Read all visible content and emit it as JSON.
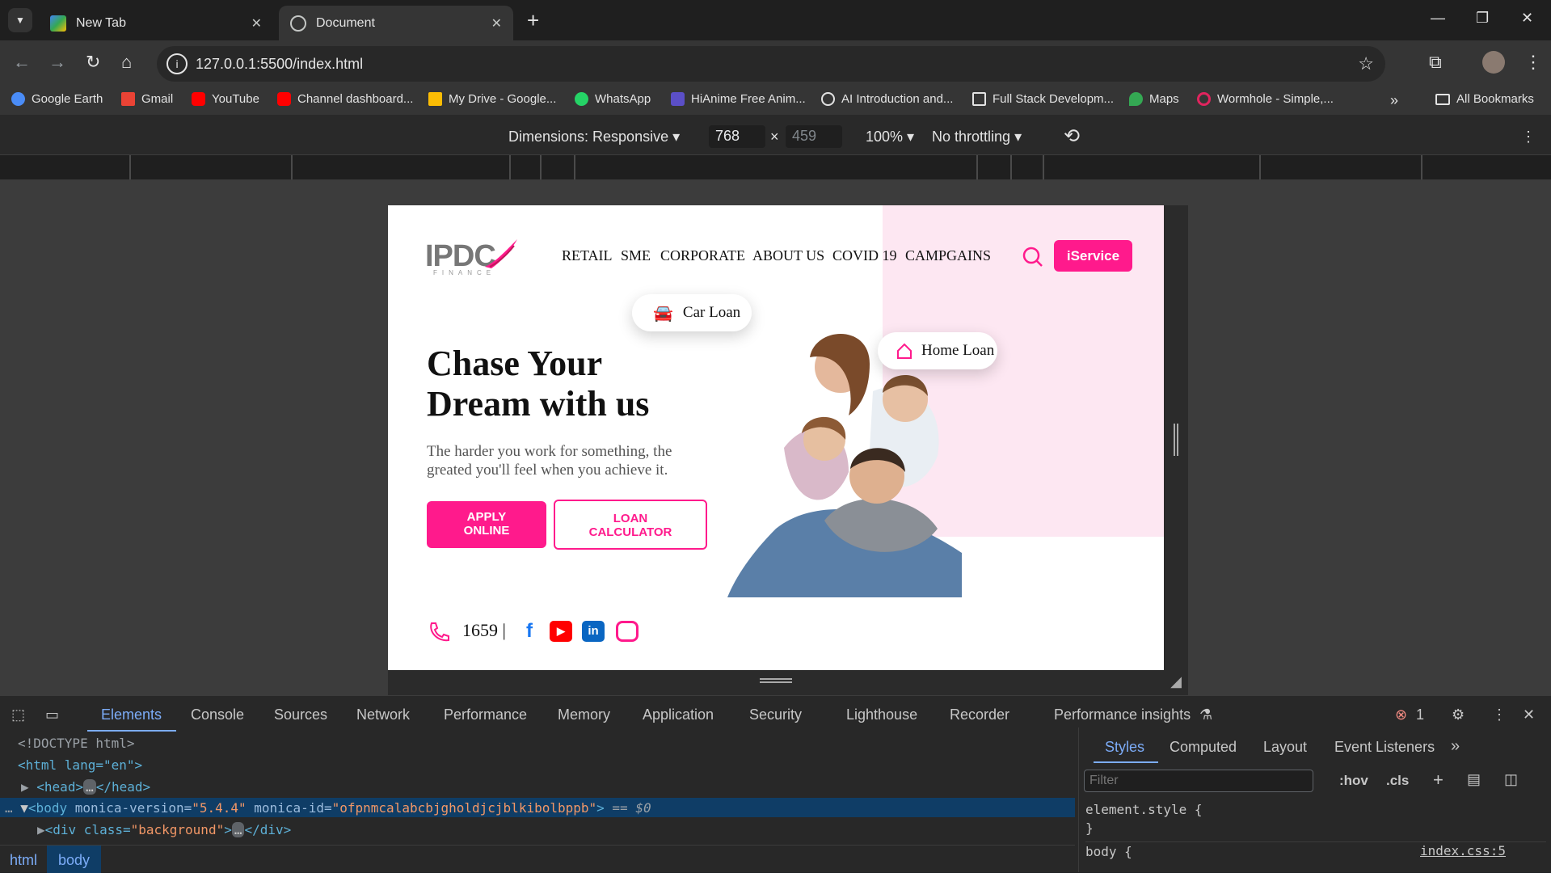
{
  "tabs": [
    {
      "title": "New Tab",
      "active": false
    },
    {
      "title": "Document",
      "active": true
    }
  ],
  "address": {
    "url": "127.0.0.1:5500/index.html"
  },
  "bookmarks": [
    {
      "label": "Google Earth",
      "icon": "google-earth-icon",
      "color": "#4a8cf7"
    },
    {
      "label": "Gmail",
      "icon": "gmail-icon",
      "color": "#ea4335"
    },
    {
      "label": "YouTube",
      "icon": "youtube-icon",
      "color": "#ff0000"
    },
    {
      "label": "Channel dashboard...",
      "icon": "youtube-studio-icon",
      "color": "#ff0000"
    },
    {
      "label": "My Drive - Google...",
      "icon": "google-drive-icon",
      "color": "#fbbc04"
    },
    {
      "label": "WhatsApp",
      "icon": "whatsapp-icon",
      "color": "#25d366"
    },
    {
      "label": "HiAnime Free Anim...",
      "icon": "hianime-icon",
      "color": "#5b4fc7"
    },
    {
      "label": "AI Introduction and...",
      "icon": "openai-icon",
      "color": "#e3e3e3"
    },
    {
      "label": "Full Stack Developm...",
      "icon": "doc-icon",
      "color": "#e3e3e3"
    },
    {
      "label": "Maps",
      "icon": "maps-icon",
      "color": "#34a853"
    },
    {
      "label": "Wormhole - Simple,...",
      "icon": "wormhole-icon",
      "color": "#e0245e"
    }
  ],
  "all_bookmarks": "All Bookmarks",
  "device_toolbar": {
    "dimensions": "Dimensions: Responsive",
    "width": "768",
    "height": "459",
    "zoom": "100%",
    "throttle": "No throttling",
    "times": "×"
  },
  "site": {
    "logo": "IPDC",
    "logo_sub": "FINANCE",
    "nav": [
      "RETAIL",
      "SME",
      "CORPORATE",
      "ABOUT US",
      "COVID 19",
      "CAMPGAINS"
    ],
    "iservice": "iService",
    "heading_line1": "Chase Your",
    "heading_line2": "Dream with us",
    "para_line1": "The harder you work for something, the",
    "para_line2": "greated you'll feel when you achieve it.",
    "apply_line1": "APPLY",
    "apply_line2": "ONLINE",
    "loan_line1": "LOAN",
    "loan_line2": "CALCULATOR",
    "car_loan": "Car Loan",
    "home_loan": "Home Loan",
    "phone": "1659",
    "phone_sep": "|",
    "brand_color": "#ff1a8c"
  },
  "devtools": {
    "tabs": [
      "Elements",
      "Console",
      "Sources",
      "Network",
      "Performance",
      "Memory",
      "Application",
      "Security",
      "Lighthouse",
      "Recorder",
      "Performance insights"
    ],
    "error_count": "1",
    "code": {
      "doctype": "<!DOCTYPE html>",
      "html_open": "<html lang=\"en\">",
      "head": "<head>",
      "head_close": "</head>",
      "body_tag": "<body",
      "body_attr1": " monica-version=",
      "body_val1": "\"5.4.4\"",
      "body_attr2": " monica-id=",
      "body_val2": "\"ofpnmcalabcbjgholdjcjblkibolbppb\"",
      "body_end": ">",
      "body_eq": " == $0",
      "div_open": "<div class=",
      "div_val": "\"background\"",
      "div_close": "</div>"
    },
    "breadcrumbs": [
      "html",
      "body"
    ],
    "style_tabs": [
      "Styles",
      "Computed",
      "Layout",
      "Event Listeners"
    ],
    "filter_placeholder": "Filter",
    "hov": ":hov",
    "cls": ".cls",
    "element_style": "element.style {",
    "close_brace": "}",
    "body_rule": "body {",
    "source": "index.css:5"
  }
}
